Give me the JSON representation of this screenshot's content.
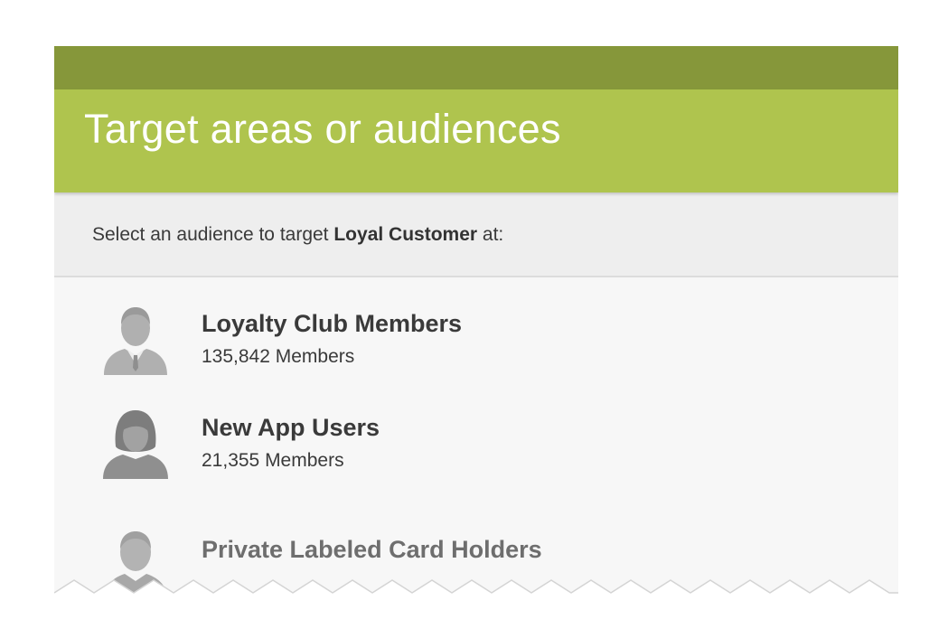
{
  "header": {
    "title": "Target areas or audiences"
  },
  "subheader": {
    "prefix": "Select an audience to target ",
    "target": "Loyal Customer",
    "suffix": " at:"
  },
  "audiences": [
    {
      "name": "Loyalty Club Members",
      "count": "135,842 Members",
      "icon": "male-user-icon"
    },
    {
      "name": "New App Users",
      "count": "21,355 Members",
      "icon": "female-user-icon"
    },
    {
      "name": "Private Labeled Card Holders",
      "count": "",
      "icon": "user-icon"
    }
  ],
  "colors": {
    "status_bar": "#86973a",
    "title_bar": "#afc44e",
    "subheader_bg": "#eeeeee",
    "list_bg": "#f7f7f7"
  }
}
